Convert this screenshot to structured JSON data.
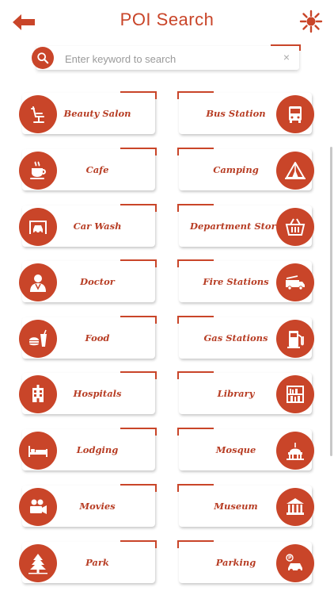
{
  "header": {
    "title": "POI Search"
  },
  "search": {
    "placeholder": "Enter keyword to search",
    "clear": "×"
  },
  "colors": {
    "accent": "#c94529",
    "label": "#b73d24"
  },
  "left_items": [
    {
      "label": "Beauty Salon",
      "icon": "chair-icon"
    },
    {
      "label": "Cafe",
      "icon": "coffee-cup-icon"
    },
    {
      "label": "Car Wash",
      "icon": "car-wash-icon"
    },
    {
      "label": "Doctor",
      "icon": "doctor-icon"
    },
    {
      "label": "Food",
      "icon": "burger-drink-icon"
    },
    {
      "label": "Hospitals",
      "icon": "hospital-building-icon"
    },
    {
      "label": "Lodging",
      "icon": "bed-icon"
    },
    {
      "label": "Movies",
      "icon": "film-camera-icon"
    },
    {
      "label": "Park",
      "icon": "tree-icon"
    }
  ],
  "right_items": [
    {
      "label": "Bus Station",
      "icon": "bus-icon"
    },
    {
      "label": "Camping",
      "icon": "tent-icon"
    },
    {
      "label": "Department Store",
      "icon": "shopping-basket-icon"
    },
    {
      "label": "Fire Stations",
      "icon": "fire-truck-icon"
    },
    {
      "label": "Gas Stations",
      "icon": "gas-pump-icon"
    },
    {
      "label": "Library",
      "icon": "bookshelf-icon"
    },
    {
      "label": "Mosque",
      "icon": "mosque-dome-icon"
    },
    {
      "label": "Museum",
      "icon": "museum-icon"
    },
    {
      "label": "Parking",
      "icon": "parking-car-icon"
    }
  ]
}
